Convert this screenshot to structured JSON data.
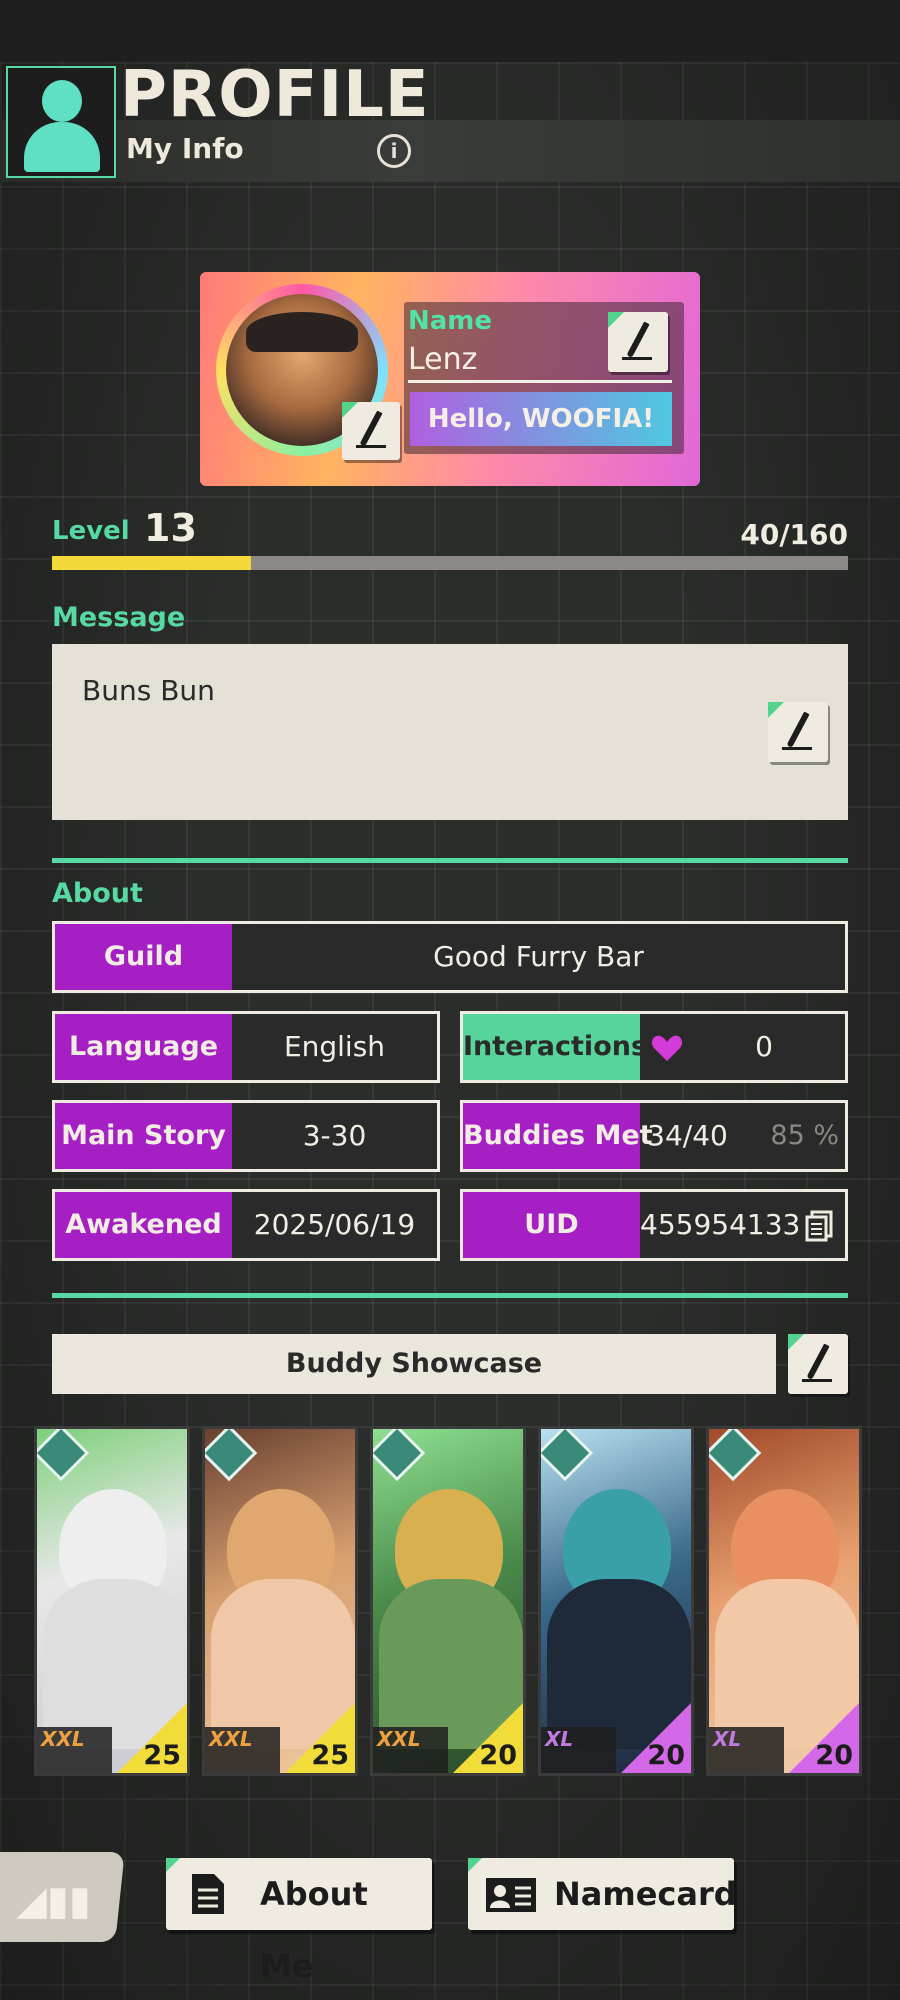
{
  "header": {
    "title": "PROFILE",
    "subtitle": "My Info"
  },
  "profile": {
    "name_label": "Name",
    "name": "Lenz",
    "greeting": "Hello, WOOFIA!"
  },
  "level": {
    "label": "Level",
    "value": "13",
    "progress_text": "40/160",
    "progress_fraction": 0.25
  },
  "message": {
    "label": "Message",
    "text": "Buns Bun"
  },
  "about": {
    "label": "About",
    "guild_key": "Guild",
    "guild_value": "Good Furry Bar",
    "language_key": "Language",
    "language_value": "English",
    "interactions_key": "Interactions",
    "interactions_value": "0",
    "main_story_key": "Main Story",
    "main_story_value": "3-30",
    "buddies_met_key": "Buddies Met",
    "buddies_met_value": "34/40",
    "buddies_met_pct": "85 %",
    "awakened_key": "Awakened",
    "awakened_value": "2025/06/19",
    "uid_key": "UID",
    "uid_value": "455954133"
  },
  "showcase": {
    "title": "Buddy Showcase",
    "cards": [
      {
        "size": "XXL",
        "level": "25",
        "rarity_color": "#f2dc3a"
      },
      {
        "size": "XXL",
        "level": "25",
        "rarity_color": "#f2dc3a"
      },
      {
        "size": "XXL",
        "level": "20",
        "rarity_color": "#f2dc3a"
      },
      {
        "size": "XL",
        "level": "20",
        "rarity_color": "#d368e8"
      },
      {
        "size": "XL",
        "level": "20",
        "rarity_color": "#d368e8"
      }
    ]
  },
  "bottom": {
    "about_me": "About Me",
    "namecard": "Namecard"
  },
  "colors": {
    "accent_green": "#57d9a3",
    "key_purple": "#a51fc4",
    "level_fill": "#f4d93a"
  }
}
